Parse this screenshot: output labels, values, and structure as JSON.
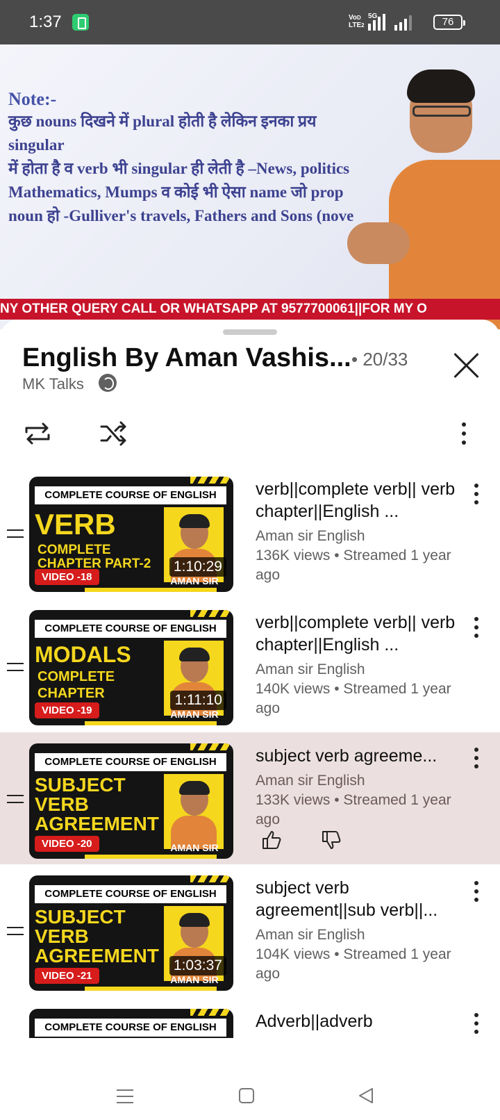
{
  "status_bar": {
    "time": "1:37",
    "network": "VoLTE",
    "signal": "5G",
    "battery": "76"
  },
  "video_player": {
    "board_title": "Note:-",
    "board_lines": [
      "कुछ nouns दिखने में plural होती है लेकिन इनका प्रय",
      "singular",
      "में होता है व verb भी singular ही लेती है –News, politics",
      "Mathematics, Mumps व कोई भी ऐसा name जो prop",
      "noun हो -Gulliver's travels, Fathers and Sons (nove"
    ],
    "ticker": "NY OTHER QUERY CALL OR WHATSAPP AT 9577700061||FOR MY O"
  },
  "playlist": {
    "title": "English By Aman Vashis...",
    "position": "• 20/33",
    "channel": "MK Talks"
  },
  "videos": [
    {
      "banner": "COMPLETE COURSE OF ENGLISH",
      "thumb_lines": [
        "VERB",
        "COMPLETE",
        "CHAPTER PART-2"
      ],
      "tag": "VIDEO -18",
      "duration": "1:10:29",
      "presenter": "AMAN SIR",
      "title": "verb||complete verb|| verb chapter||English ...",
      "channel": "Aman sir English",
      "stats": "136K views • Streamed 1 year ago"
    },
    {
      "banner": "COMPLETE COURSE OF ENGLISH",
      "thumb_lines": [
        "MODALS",
        "COMPLETE",
        "CHAPTER"
      ],
      "tag": "VIDEO -19",
      "duration": "1:11:10",
      "presenter": "AMAN SIR",
      "title": "verb||complete verb|| verb chapter||English ...",
      "channel": "Aman sir English",
      "stats": "140K views • Streamed 1 year ago"
    },
    {
      "banner": "COMPLETE COURSE OF ENGLISH",
      "thumb_lines": [
        "SUBJECT",
        "VERB",
        "AGREEMENT"
      ],
      "tag": "VIDEO -20",
      "duration": "",
      "presenter": "AMAN SIR",
      "title": "subject verb agreeme...",
      "channel": "Aman sir English",
      "stats": "133K views • Streamed 1 year ago"
    },
    {
      "banner": "COMPLETE COURSE OF ENGLISH",
      "thumb_lines": [
        "SUBJECT",
        "VERB",
        "AGREEMENT"
      ],
      "tag": "VIDEO -21",
      "duration": "1:03:37",
      "presenter": "AMAN SIR",
      "title": "subject verb agreement||sub verb||...",
      "channel": "Aman sir English",
      "stats": "104K views • Streamed 1 year ago"
    },
    {
      "banner": "COMPLETE COURSE OF ENGLISH",
      "title": "Adverb||adverb"
    }
  ],
  "icons": {
    "repeat": "repeat-icon",
    "shuffle": "shuffle-icon",
    "more": "more-vert-icon",
    "close": "close-icon",
    "like": "thumb-up-icon",
    "dislike": "thumb-down-icon"
  },
  "colors": {
    "accent_active_row": "#ecdfdf",
    "thumb_yellow": "#f5d71e",
    "ticker_red": "#c7142b"
  }
}
